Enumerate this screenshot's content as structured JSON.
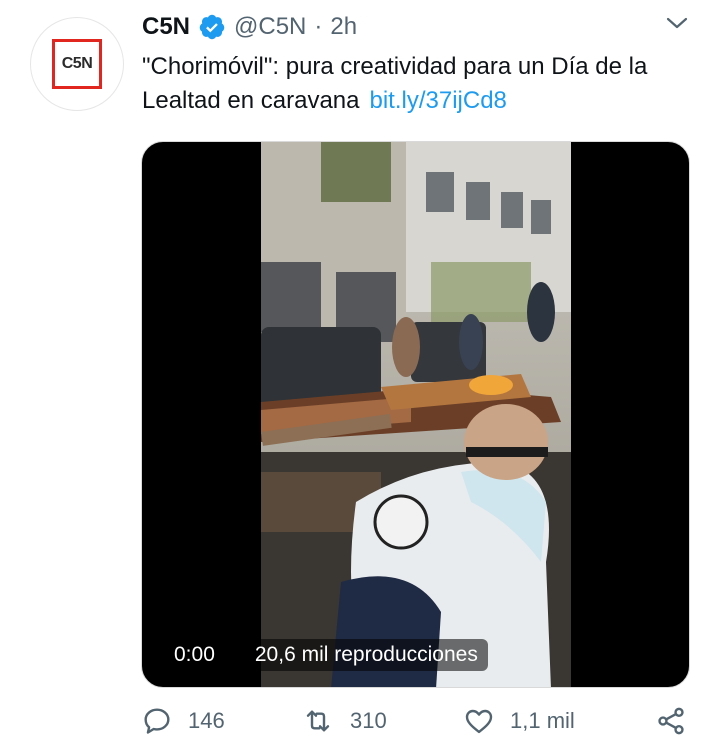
{
  "tweet": {
    "author_name": "C5N",
    "handle": "@C5N",
    "separator": "·",
    "time": "2h",
    "avatar_text": "C5N",
    "text": "\"Chorimóvil\": pura creatividad para un Día de la Lealtad en caravana",
    "link": "bit.ly/37ijCd8"
  },
  "video": {
    "timestamp": "0:00",
    "views": "20,6 mil reproducciones"
  },
  "actions": {
    "replies": "146",
    "retweets": "310",
    "likes": "1,1 mil"
  },
  "colors": {
    "accent": "#1d9bf0",
    "muted": "#536471",
    "brand_red": "#e0261e"
  },
  "icons": [
    "verified-badge-icon",
    "chevron-down-icon",
    "reply-icon",
    "retweet-icon",
    "like-icon",
    "share-icon"
  ]
}
